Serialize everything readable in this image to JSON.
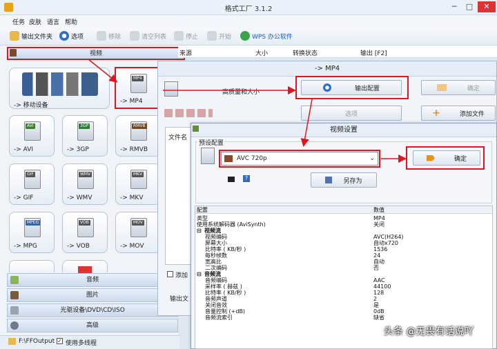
{
  "window": {
    "title": "格式工厂 3.1.2",
    "minimize": "─",
    "maximize": "□",
    "close": "✕"
  },
  "menu": [
    "任务",
    "皮肤",
    "语言",
    "帮助"
  ],
  "toolbar": {
    "output_folder": "输出文件夹",
    "options": "选项",
    "remove": "移除",
    "clear_list": "清空列表",
    "stop": "停止",
    "start": "开始",
    "wps": "WPS 办公软件"
  },
  "sidebar": {
    "video_header": "视频",
    "mobile_device": "-> 移动设备",
    "tiles": [
      {
        "fmt": "MP4",
        "label": "-> MP4"
      },
      {
        "fmt": "AVI",
        "label": "-> AVI"
      },
      {
        "fmt": "3GP",
        "label": "-> 3GP"
      },
      {
        "fmt": "RMVB",
        "label": "-> RMVB"
      },
      {
        "fmt": "GIF",
        "label": "-> GIF"
      },
      {
        "fmt": "WMV",
        "label": "-> WMV"
      },
      {
        "fmt": "MKV",
        "label": "-> MKV"
      },
      {
        "fmt": "MPEG",
        "label": "-> MPG"
      },
      {
        "fmt": "VOB",
        "label": "-> VOB"
      },
      {
        "fmt": "MOV",
        "label": "-> MOV"
      }
    ],
    "categories": [
      "音频",
      "图片",
      "光驱设备\\DVD\\CD\\ISO",
      "高级"
    ]
  },
  "status": {
    "path": "F:\\FFOutput",
    "multithread": "使用多线程"
  },
  "list_headers": [
    "来源",
    "大小",
    "转换状态",
    "输出 [F2]"
  ],
  "convert_dialog": {
    "title": "-> MP4",
    "quality_label": "高质量和大小",
    "output_config": "输出配置",
    "ok": "确定",
    "options": "选项",
    "add_file": "添加文件",
    "file_name_partial": "文件名",
    "add_partial": "添加",
    "output_partial": "输出文"
  },
  "video_settings": {
    "title": "视频设置",
    "preset_group": "预设配置",
    "preset_value": "AVC 720p",
    "ok": "确定",
    "save_as": "另存为",
    "table_header": [
      "配置",
      "数值"
    ],
    "rows": [
      {
        "k": "类型",
        "v": "MP4",
        "t": ""
      },
      {
        "k": "使用系统解码器 (AviSynth)",
        "v": "关闭",
        "t": ""
      },
      {
        "k": "视频流",
        "v": "",
        "t": "sec"
      },
      {
        "k": "视频编码",
        "v": "AVC(H264)",
        "t": "sub"
      },
      {
        "k": "屏幕大小",
        "v": "自动x720",
        "t": "sub"
      },
      {
        "k": "比特率 ( KB/秒 )",
        "v": "1536",
        "t": "sub"
      },
      {
        "k": "每秒帧数",
        "v": "24",
        "t": "sub"
      },
      {
        "k": "宽高比",
        "v": "自动",
        "t": "sub"
      },
      {
        "k": "二次编码",
        "v": "否",
        "t": "sub"
      },
      {
        "k": "音频流",
        "v": "",
        "t": "sec"
      },
      {
        "k": "音频编码",
        "v": "AAC",
        "t": "sub"
      },
      {
        "k": "采样率 ( 赫兹 )",
        "v": "44100",
        "t": "sub"
      },
      {
        "k": "比特率 ( KB/秒 )",
        "v": "128",
        "t": "sub"
      },
      {
        "k": "音频声道",
        "v": "2",
        "t": "sub"
      },
      {
        "k": "关闭音效",
        "v": "是",
        "t": "sub"
      },
      {
        "k": "音量控制 (+dB)",
        "v": "0dB",
        "t": "sub"
      },
      {
        "k": "音频流索引",
        "v": "缺省",
        "t": "sub"
      }
    ]
  },
  "watermark": "头条 @无畏有话说吖",
  "colors": {
    "accent_red": "#e0141f"
  }
}
